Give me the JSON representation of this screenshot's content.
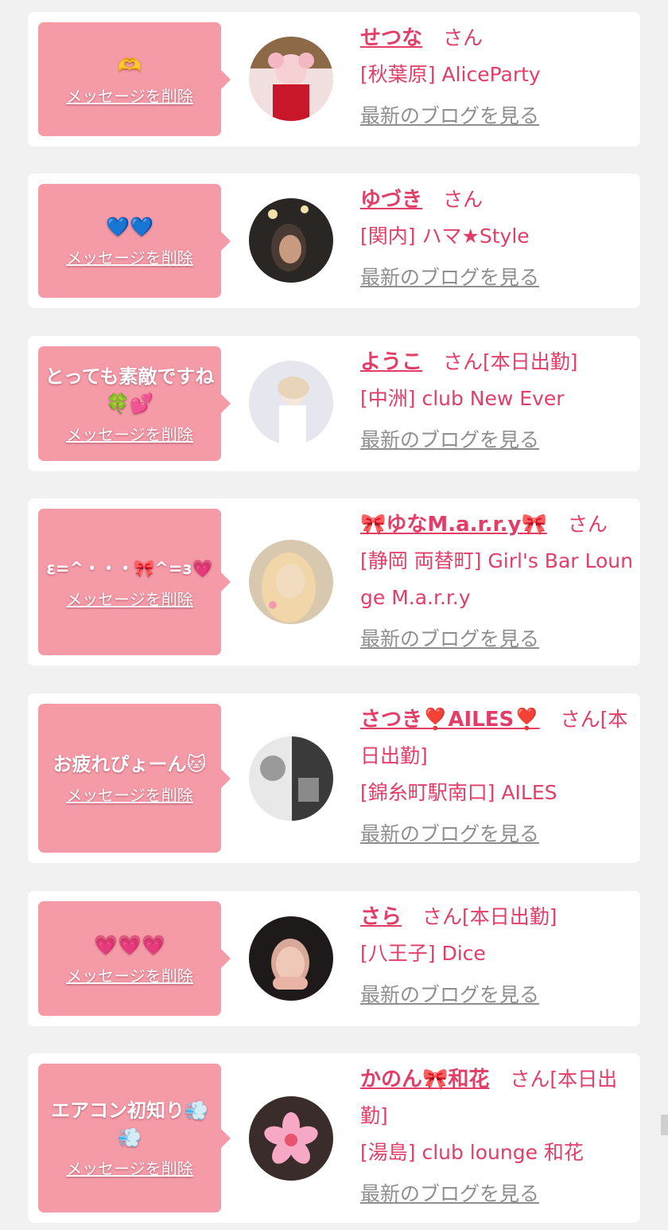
{
  "items": [
    {
      "message": "🫶",
      "delete_label": "メッセージを削除",
      "name": "せつな",
      "san": "さん",
      "shop": "[秋葉原] AliceParty",
      "blog": "最新のブログを見る",
      "avatar_colors": [
        "#f6d0d2",
        "#c8172a",
        "#a06a3a"
      ]
    },
    {
      "message": "💙💙",
      "delete_label": "メッセージを削除",
      "name": "ゆづき",
      "san": "さん",
      "shop": "[関内] ハマ★Style",
      "blog": "最新のブログを見る",
      "avatar_colors": [
        "#2a2624",
        "#5a4a40",
        "#c89a80"
      ]
    },
    {
      "message": "とっても素敵ですね🍀💕",
      "delete_label": "メッセージを削除",
      "name": "ようこ",
      "san": "さん[本日出勤]",
      "shop": "[中洲] club New Ever",
      "blog": "最新のブログを見る",
      "avatar_colors": [
        "#e6e6ee",
        "#f4e6d8",
        "#ffffff"
      ]
    },
    {
      "message": "ε=^・・・🎀^=з💗",
      "delete_label": "メッセージを削除",
      "name": "🎀ゆなM.a.r.r.y🎀",
      "san": "さん",
      "shop": "[静岡 両替町] Girl's Bar Lounge M.a.r.r.y",
      "blog": "最新のブログを見る",
      "avatar_colors": [
        "#d8c8b0",
        "#f2dcc0",
        "#e7b6a0"
      ]
    },
    {
      "message": "お疲れぴょーん🐱",
      "delete_label": "メッセージを削除",
      "name": "さつき❣️AILES❣️",
      "san": "さん[本日出勤]",
      "shop": "[錦糸町駅南口] AILES",
      "blog": "最新のブログを見る",
      "avatar_colors": [
        "#e8e8e8",
        "#3a3a3a",
        "#9a9a9a"
      ]
    },
    {
      "message": "💗💗💗",
      "delete_label": "メッセージを削除",
      "name": "さら",
      "san": "さん[本日出勤]",
      "shop": "[八王子] Dice",
      "blog": "最新のブログを見る",
      "avatar_colors": [
        "#1e1a1a",
        "#d8a89a",
        "#f0c8b8"
      ]
    },
    {
      "message": "エアコン初知り💨💨",
      "delete_label": "メッセージを削除",
      "name": "かのん🎀和花",
      "san": "さん[本日出勤]",
      "shop": "[湯島] club lounge 和花",
      "blog": "最新のブログを見る",
      "avatar_colors": [
        "#3a2c2a",
        "#f7a8c4",
        "#e8526f"
      ]
    }
  ]
}
